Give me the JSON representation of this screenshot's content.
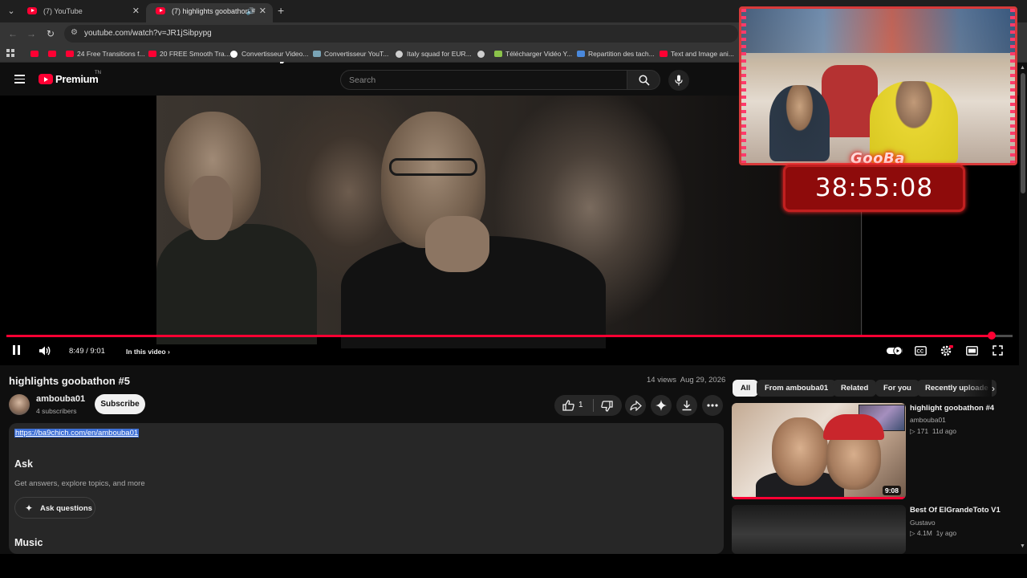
{
  "browser": {
    "tabs": [
      {
        "label": "(7) YouTube",
        "active": false
      },
      {
        "label": "(7) highlights goobathon #",
        "active": true
      }
    ],
    "url": "youtube.com/watch?v=JR1jSibpypg",
    "bookmarks": [
      {
        "label": "",
        "icon": "youtube-icon"
      },
      {
        "label": "",
        "icon": "youtube-icon"
      },
      {
        "label": "24 Free Transitions f...",
        "icon": "youtube-icon"
      },
      {
        "label": "20 FREE Smooth Tra...",
        "icon": "youtube-icon"
      },
      {
        "label": "Convertisseur Video...",
        "icon": "google-icon"
      },
      {
        "label": "Convertisseur YouT...",
        "icon": "converter-icon"
      },
      {
        "label": "Italy squad for EUR...",
        "icon": "globe-icon"
      },
      {
        "label": "",
        "icon": "globe-icon"
      },
      {
        "label": "Télécharger Vidéo Y...",
        "icon": "download-icon"
      },
      {
        "label": "Repartition des tach...",
        "icon": "docs-icon"
      },
      {
        "label": "Text and Image ani...",
        "icon": "youtube-icon"
      }
    ]
  },
  "header": {
    "logo_text": "Premium",
    "logo_superscript": "TN",
    "search_placeholder": "Search"
  },
  "player": {
    "time": "8:49 / 9:01",
    "in_this_video": "In this video",
    "progress": 0.979,
    "overlay_name": "GooBa",
    "overlay_timer": "38:55:08"
  },
  "video": {
    "title": "highlights goobathon #5",
    "views": "14 views",
    "date": "Aug 29, 2026",
    "channel": "ambouba01",
    "subscribers": "4 subscribers",
    "subscribe_label": "Subscribe",
    "like_count": "1"
  },
  "description": {
    "link": "https://ba9chich.com/en/ambouba01",
    "ask_heading": "Ask",
    "ask_sub": "Get answers, explore topics, and more",
    "ask_button": "Ask questions",
    "music_heading": "Music"
  },
  "sidebar": {
    "chips": [
      "All",
      "From ambouba01",
      "Related",
      "For you",
      "Recently uploade"
    ],
    "recommendations": [
      {
        "title": "highlight goobathon #4",
        "channel": "ambouba01",
        "views": "171",
        "age": "11d ago",
        "duration": "9:08"
      },
      {
        "title": "Best Of ElGrandeToto V1",
        "channel": "Gustavo",
        "views": "4.1M",
        "age": "1y ago",
        "duration": ""
      }
    ]
  },
  "colors": {
    "accent": "#ff0033",
    "background": "#0f0f0f",
    "timer_box": "#8e0b0b"
  }
}
